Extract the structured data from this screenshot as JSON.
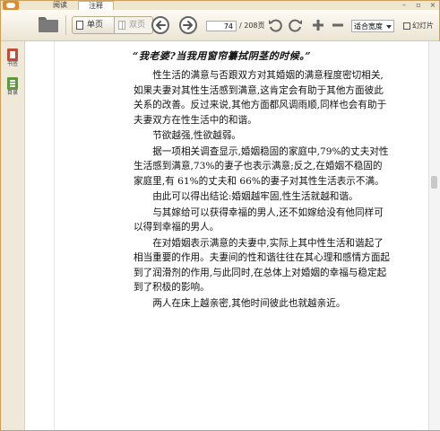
{
  "tabs": {
    "read": "阅读",
    "notes": "注释"
  },
  "toolbar": {
    "single_page": "单页",
    "double_page": "双页",
    "page_current": "74",
    "page_total": "/ 208页",
    "zoom_value": "适合宽度",
    "slideshow": "幻灯片"
  },
  "sidebar": {
    "bookmarks": "书签",
    "toc": "目录"
  },
  "doc": {
    "title": "“我老婆?当我用窗帘纂拭阴茎的时候。”",
    "paragraphs": [
      {
        "lines": [
          "性生活的满意与否跟双方对其婚姻的满意程度密切相关,",
          "如果夫妻对其性生活感到满意,这肯定会有助于其他方面彼此",
          "关系的改善。反过来说,其他方面都风调雨顺,同样也会有助于",
          "夫妻双方在性生活中的和谐。"
        ]
      },
      {
        "lines": [
          "节欲越强,性欲越弱。"
        ]
      },
      {
        "lines": [
          "据一项相关调查显示,婚姻稳固的家庭中,79%的丈夫对性",
          "生活感到满意,73%的妻子也表示满意;反之,在婚姻不稳固的",
          "家庭里,有 61%的丈夫和 66%的妻子对其性生活表示不满。"
        ]
      },
      {
        "lines": [
          "由此可以得出结论:婚姻越牢固,性生活就越和谐。"
        ]
      },
      {
        "lines": [
          "与其嫁给可以获得幸福的男人,还不如嫁给没有他同样可",
          "以得到幸福的男人。"
        ]
      },
      {
        "lines": [
          "在对婚姻表示满意的夫妻中,实际上其中性生活和谐起了",
          "相当重要的作用。夫妻间的性和谐往往在其心理和感情方面起",
          "到了润滑剂的作用,与此同时,在总体上对婚姻的幸福与稳定起",
          "到了积极的影响。"
        ]
      },
      {
        "lines": [
          "两人在床上越亲密,其他时间彼此也就越亲近。"
        ]
      }
    ]
  }
}
